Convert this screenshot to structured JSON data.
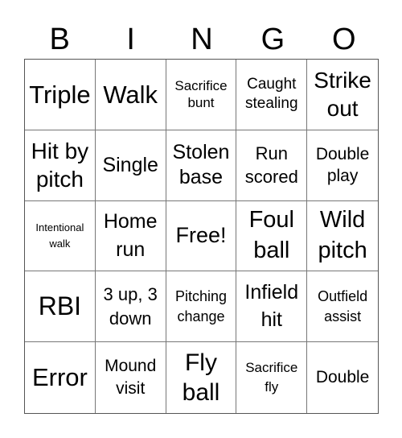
{
  "header": {
    "letters": [
      "B",
      "I",
      "N",
      "G",
      "O"
    ]
  },
  "grid": {
    "rows": [
      [
        "Triple",
        "Walk",
        "Sacrifice bunt",
        "Caught stealing",
        "Strike out"
      ],
      [
        "Hit by pitch",
        "Single",
        "Stolen base",
        "Run scored",
        "Double play"
      ],
      [
        "Intentional walk",
        "Home run",
        "Free!",
        "Foul ball",
        "Wild pitch"
      ],
      [
        "RBI",
        "3 up, 3 down",
        "Pitching change",
        "Infield hit",
        "Outfield assist"
      ],
      [
        "Error",
        "Mound visit",
        "Fly ball",
        "Sacrifice fly",
        "Double"
      ]
    ],
    "free_space": "Free!"
  },
  "cells": {
    "r0c0": "Triple",
    "r0c1": "Walk",
    "r0c2": "Sacrifice bunt",
    "r0c3": "Caught stealing",
    "r0c4": "Strike out",
    "r1c0": "Hit by pitch",
    "r1c1": "Single",
    "r1c2": "Stolen base",
    "r1c3": "Run scored",
    "r1c4": "Double play",
    "r2c0": "Intentional walk",
    "r2c1": "Home run",
    "r2c2": "Free!",
    "r2c3": "Foul ball",
    "r2c4": "Wild pitch",
    "r3c0": "RBI",
    "r3c1": "3 up, 3 down",
    "r3c2": "Pitching change",
    "r3c3": "Infield hit",
    "r3c4": "Outfield assist",
    "r4c0": "Error",
    "r4c1": "Mound visit",
    "r4c2": "Fly ball",
    "r4c3": "Sacrifice fly",
    "r4c4": "Double"
  }
}
